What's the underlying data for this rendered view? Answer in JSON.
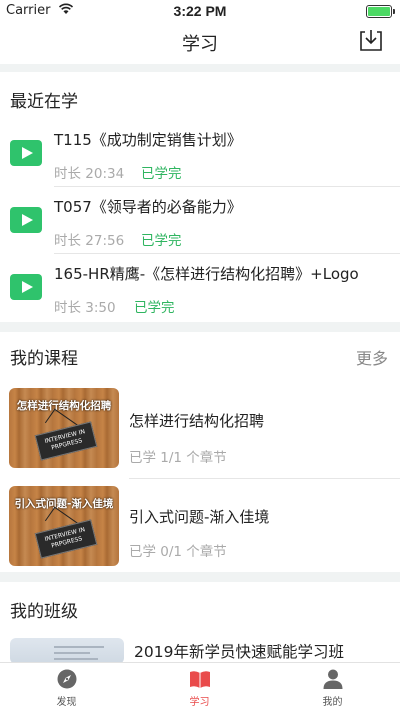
{
  "status_bar": {
    "carrier": "Carrier",
    "time": "3:22 PM"
  },
  "nav": {
    "title": "学习",
    "download_icon": "download-icon"
  },
  "recent": {
    "heading": "最近在学",
    "items": [
      {
        "title": "T115《成功制定销售计划》",
        "duration": "时长 20:34",
        "status": "已学完"
      },
      {
        "title": "T057《领导者的必备能力》",
        "duration": "时长 27:56",
        "status": "已学完"
      },
      {
        "title": "165-HR精鹰-《怎样进行结构化招聘》+Logo",
        "duration": "时长 3:50",
        "status": "已学完"
      }
    ]
  },
  "courses": {
    "heading": "我的课程",
    "more": "更多",
    "items": [
      {
        "title": "怎样进行结构化招聘",
        "progress": "已学 1/1 个章节",
        "thumb_text": "怎样进行结构化招聘",
        "sign_text": "INTERVIEW IN PRPGRESS"
      },
      {
        "title": "引入式问题-渐入佳境",
        "progress": "已学 0/1 个章节",
        "thumb_text": "引入式问题-渐入佳境",
        "sign_text": "INTERVIEW IN PRPGRESS"
      }
    ]
  },
  "classes": {
    "heading": "我的班级",
    "items": [
      {
        "title": "2019年新学员快速赋能学习班"
      }
    ]
  },
  "tabs": [
    {
      "label": "发现",
      "icon": "compass-icon",
      "active": false
    },
    {
      "label": "学习",
      "icon": "book-icon",
      "active": true
    },
    {
      "label": "我的",
      "icon": "person-icon",
      "active": false
    }
  ],
  "colors": {
    "accent_green": "#2fc36c",
    "status_green": "#2fb560",
    "tab_active": "#e94b4b"
  }
}
